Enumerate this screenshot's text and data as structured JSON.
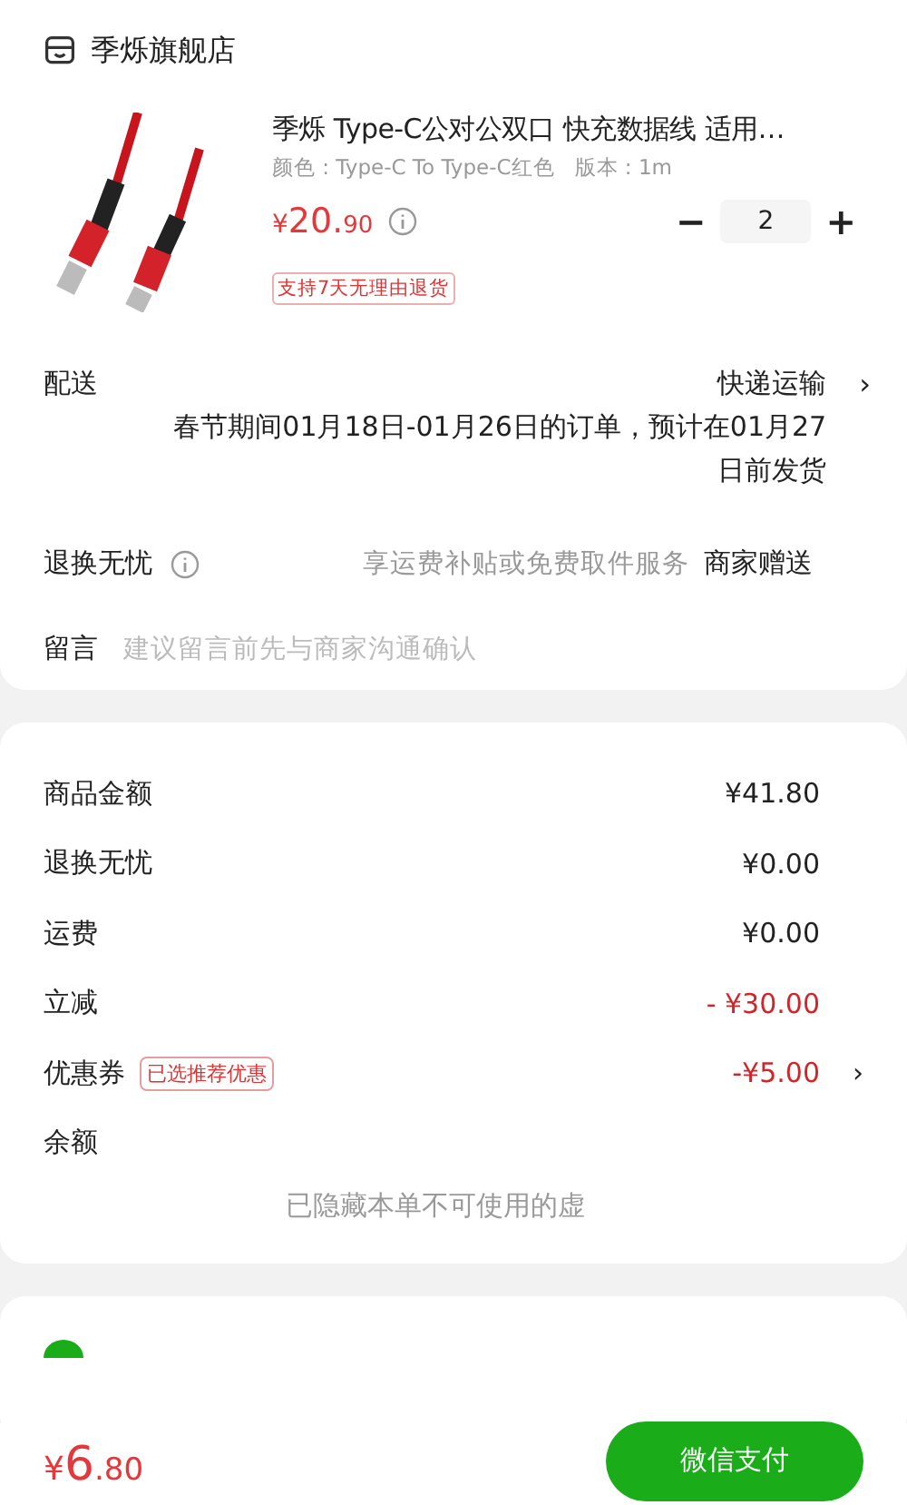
{
  "store": {
    "name": "季烁旗舰店"
  },
  "product": {
    "title": "季烁 Type-C公对公双口 快充数据线 适用…",
    "spec": "颜色 : Type-C To Type-C红色   版本 : 1m",
    "price_symbol": "¥",
    "price_int": "20.",
    "price_dec": "90",
    "quantity": "2",
    "minus": "−",
    "plus": "+",
    "badge": "支持7天无理由退货"
  },
  "options": [
    {
      "kind": "delivery",
      "label": "配送",
      "value": "快递运输",
      "note": "春节期间01月18日-01月26日的订单，预计在01月27日前发货",
      "chevron": "›"
    },
    {
      "kind": "service",
      "label": "退换无忧",
      "hint": "享运费补贴或免费取件服务",
      "value": "商家赠送"
    },
    {
      "kind": "message",
      "label": "留言",
      "placeholder": "建议留言前先与商家沟通确认"
    }
  ],
  "summary": [
    {
      "kind": "plain",
      "label": "商品金额",
      "value": "¥41.80"
    },
    {
      "kind": "plain",
      "label": "退换无忧",
      "value": "¥0.00"
    },
    {
      "kind": "plain",
      "label": "运费",
      "value": "¥0.00"
    },
    {
      "kind": "discount",
      "label": "立减",
      "value": "- ¥30.00"
    },
    {
      "kind": "coupon",
      "label": "优惠券",
      "tag": "已选推荐优惠",
      "value": "-¥5.00",
      "chevron": "›"
    },
    {
      "kind": "plain",
      "label": "余额"
    }
  ],
  "hidden_note": "已隐藏本单不可使用的虚",
  "footer": {
    "symbol": "¥",
    "amount_int": "6",
    "amount_dec": ".80",
    "pay_button": "微信支付"
  }
}
